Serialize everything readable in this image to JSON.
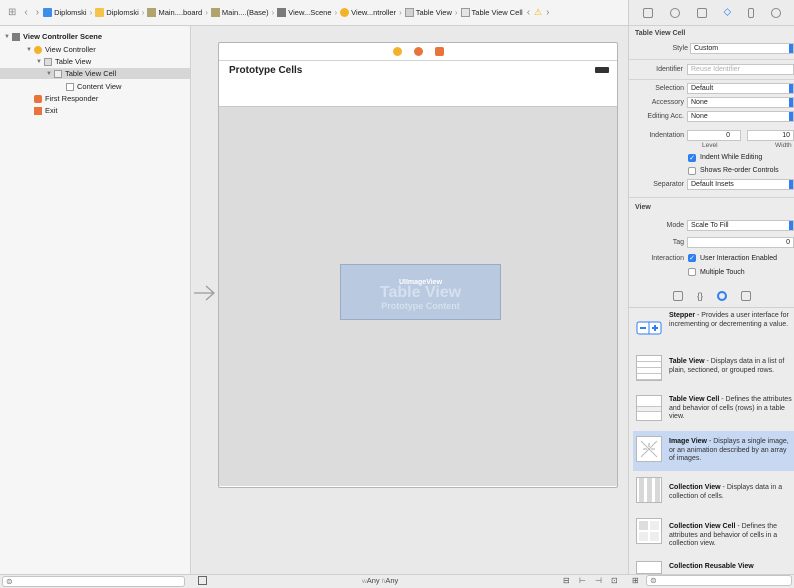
{
  "jumpbar": {
    "crumbs": [
      "Diplomski",
      "Diplomski",
      "Main....board",
      "Main....(Base)",
      "View...Scene",
      "View...ntroller",
      "Table View",
      "Table View Cell"
    ]
  },
  "outline": {
    "scene": "View Controller Scene",
    "controller": "View Controller",
    "table_view": "Table View",
    "table_view_cell": "Table View Cell",
    "content_view": "Content View",
    "first_responder": "First Responder",
    "exit": "Exit"
  },
  "canvas": {
    "prototype_cells": "Prototype Cells",
    "image_view_label": "UIImageView",
    "table_view_big": "Table View",
    "prototype_content": "Prototype Content"
  },
  "bottombar": {
    "w_label": "w",
    "w_value": "Any",
    "h_label": "h",
    "h_value": "Any"
  },
  "inspector": {
    "table_view_cell_header": "Table View Cell",
    "style_label": "Style",
    "style_value": "Custom",
    "identifier_label": "Identifier",
    "identifier_placeholder": "Reuse Identifier",
    "selection_label": "Selection",
    "selection_value": "Default",
    "accessory_label": "Accessory",
    "accessory_value": "None",
    "editing_label": "Editing Acc.",
    "editing_value": "None",
    "indentation_label": "Indentation",
    "indent_level": "0",
    "indent_width": "10",
    "level_label": "Level",
    "width_label": "Width",
    "indent_while_editing": "Indent While Editing",
    "shows_reorder": "Shows Re-order Controls",
    "separator_label": "Separator",
    "separator_value": "Default Insets",
    "view_header": "View",
    "mode_label": "Mode",
    "mode_value": "Scale To Fill",
    "tag_label": "Tag",
    "tag_value": "0",
    "interaction_label": "Interaction",
    "user_interaction": "User Interaction Enabled",
    "multiple_touch": "Multiple Touch"
  },
  "library": [
    {
      "name": "Stepper",
      "desc": " - Provides a user interface for incrementing or decrementing a value."
    },
    {
      "name": "Table View",
      "desc": " - Displays data in a list of plain, sectioned, or grouped rows."
    },
    {
      "name": "Table View Cell",
      "desc": " - Defines the attributes and behavior of cells (rows) in a table view."
    },
    {
      "name": "Image View",
      "desc": " - Displays a single image, or an animation described by an array of images."
    },
    {
      "name": "Collection View",
      "desc": " - Displays data in a collection of cells."
    },
    {
      "name": "Collection View Cell",
      "desc": " - Defines the attributes and behavior of cells in a collection view."
    },
    {
      "name": "Collection Reusable View",
      "desc": ""
    }
  ],
  "colors": {
    "accent": "#2f7ff0",
    "selection": "#c6d8f2",
    "image_view": "#b9c9df"
  }
}
